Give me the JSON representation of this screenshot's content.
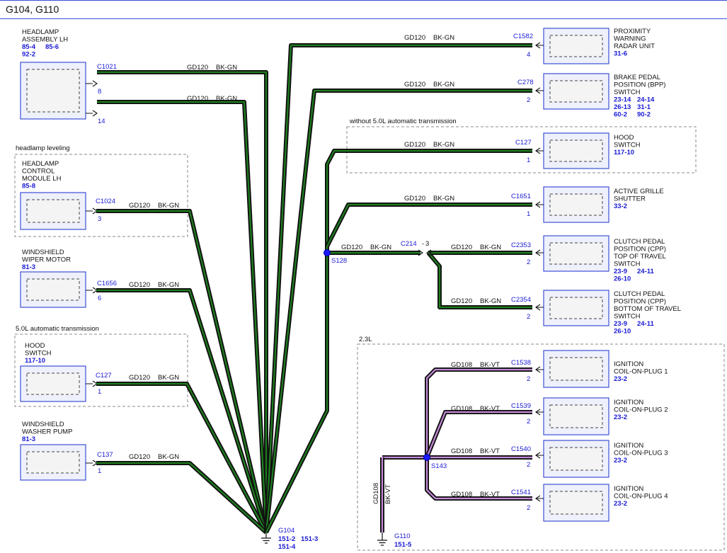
{
  "header": {
    "title": "G104, G110"
  },
  "groups": {
    "headlamp_leveling": "headlamp leveling",
    "auto_trans_50": "5.0L automatic transmission",
    "without_50": "without 5.0L automatic transmission",
    "engine_23": "2.3L"
  },
  "wire": {
    "gd120": "GD120",
    "bkgn": "BK-GN",
    "gd108": "GD108",
    "bkvt": "BK-VT"
  },
  "splices": {
    "s128": "S128",
    "s143": "S143"
  },
  "inline_connector": {
    "id": "C214",
    "pin_a": "3",
    "pin_b": "3"
  },
  "grounds": {
    "g104": {
      "id": "G104",
      "refs": [
        "151-2",
        "151-3",
        "151-4"
      ]
    },
    "g110": {
      "id": "G110",
      "refs": [
        "151-5"
      ]
    }
  },
  "left_components": [
    {
      "key": "hl",
      "name": [
        "HEADLAMP",
        "ASSEMBLY LH"
      ],
      "refs": [
        "85-4",
        "85-6",
        "92-2"
      ],
      "connector": "C1021",
      "pins": [
        "8",
        "14"
      ]
    },
    {
      "key": "hcm",
      "name": [
        "HEADLAMP",
        "CONTROL",
        "MODULE LH"
      ],
      "refs": [
        "85-8"
      ],
      "connector": "C1024",
      "pins": [
        "3"
      ]
    },
    {
      "key": "wwm",
      "name": [
        "WINDSHIELD",
        "WIPER MOTOR"
      ],
      "refs": [
        "81-3"
      ],
      "connector": "C1656",
      "pins": [
        "6"
      ]
    },
    {
      "key": "hsl",
      "name": [
        "HOOD",
        "SWITCH"
      ],
      "refs": [
        "117-10"
      ],
      "connector": "C127",
      "pins": [
        "1"
      ]
    },
    {
      "key": "wwp",
      "name": [
        "WINDSHIELD",
        "WASHER PUMP"
      ],
      "refs": [
        "81-3"
      ],
      "connector": "C137",
      "pins": [
        "1"
      ]
    }
  ],
  "right_components": [
    {
      "key": "prox",
      "name": [
        "PROXIMITY",
        "WARNING",
        "RADAR UNIT"
      ],
      "refs": [
        "31-6"
      ],
      "connector": "C1582",
      "pins": [
        "4"
      ]
    },
    {
      "key": "bpp",
      "name": [
        "BRAKE PEDAL",
        "POSITION (BPP)",
        "SWITCH"
      ],
      "refs": [
        "23-14",
        "24-14",
        "26-13",
        "31-1",
        "60-2",
        "90-2"
      ],
      "connector": "C278",
      "pins": [
        "2"
      ]
    },
    {
      "key": "hsr",
      "name": [
        "HOOD",
        "SWITCH"
      ],
      "refs": [
        "117-10"
      ],
      "connector": "C127",
      "pins": [
        "1"
      ]
    },
    {
      "key": "ags",
      "name": [
        "ACTIVE GRILLE",
        "SHUTTER"
      ],
      "refs": [
        "33-2"
      ],
      "connector": "C1651",
      "pins": [
        "1"
      ]
    },
    {
      "key": "cpp1",
      "name": [
        "CLUTCH PEDAL",
        "POSITION (CPP)",
        "TOP OF TRAVEL",
        "SWITCH"
      ],
      "refs": [
        "23-9",
        "24-11",
        "26-10"
      ],
      "connector": "C2353",
      "pins": [
        "2"
      ]
    },
    {
      "key": "cpp2",
      "name": [
        "CLUTCH PEDAL",
        "POSITION (CPP)",
        "BOTTOM OF TRAVEL",
        "SWITCH"
      ],
      "refs": [
        "23-9",
        "24-11",
        "26-10"
      ],
      "connector": "C2354",
      "pins": [
        "2"
      ]
    },
    {
      "key": "cop1",
      "name": [
        "IGNITION",
        "COIL-ON-PLUG 1"
      ],
      "refs": [
        "23-2"
      ],
      "connector": "C1538",
      "pins": [
        "2"
      ]
    },
    {
      "key": "cop2",
      "name": [
        "IGNITION",
        "COIL-ON-PLUG 2"
      ],
      "refs": [
        "23-2"
      ],
      "connector": "C1539",
      "pins": [
        "2"
      ]
    },
    {
      "key": "cop3",
      "name": [
        "IGNITION",
        "COIL-ON-PLUG 3"
      ],
      "refs": [
        "23-2"
      ],
      "connector": "C1540",
      "pins": [
        "2"
      ]
    },
    {
      "key": "cop4",
      "name": [
        "IGNITION",
        "COIL-ON-PLUG 4"
      ],
      "refs": [
        "23-2"
      ],
      "connector": "C1541",
      "pins": [
        "2"
      ]
    }
  ]
}
